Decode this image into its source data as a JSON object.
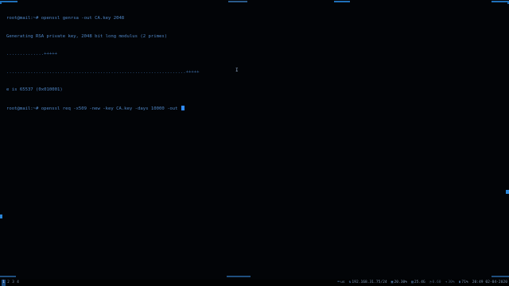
{
  "terminal": {
    "lines": [
      "root@mail:~# openssl genrsa -out CA.key 2048",
      "Generating RSA private key, 2048 bit long modulus (2 primes)",
      "..............+++++",
      "...................................................................+++++",
      "e is 65537 (0x010001)",
      "root@mail:~# openssl req -x509 -new -key CA.key -days 10000 -out "
    ]
  },
  "statusbar": {
    "workspaces": [
      "1",
      "2",
      "3",
      "4"
    ],
    "active_workspace": "1",
    "keyboard_layout": "us",
    "network": "192.168.31.75/24",
    "cpu": "20.30%",
    "memory": "25.4G",
    "load": "0.60",
    "volume": "30%",
    "battery": "71%",
    "datetime": "20:49 02-04-2020"
  },
  "icons": {
    "keyboard": "keyboard-icon",
    "network": "network-icon",
    "cpu": "cpu-icon",
    "memory": "memory-icon",
    "load": "load-icon",
    "volume": "volume-icon",
    "battery": "battery-icon",
    "clock": "clock-icon"
  },
  "colors": {
    "background": "#000000",
    "terminal_text": "#4f86c6",
    "cursor": "#2f8bff",
    "hud_accent": "#1f6fb8"
  }
}
